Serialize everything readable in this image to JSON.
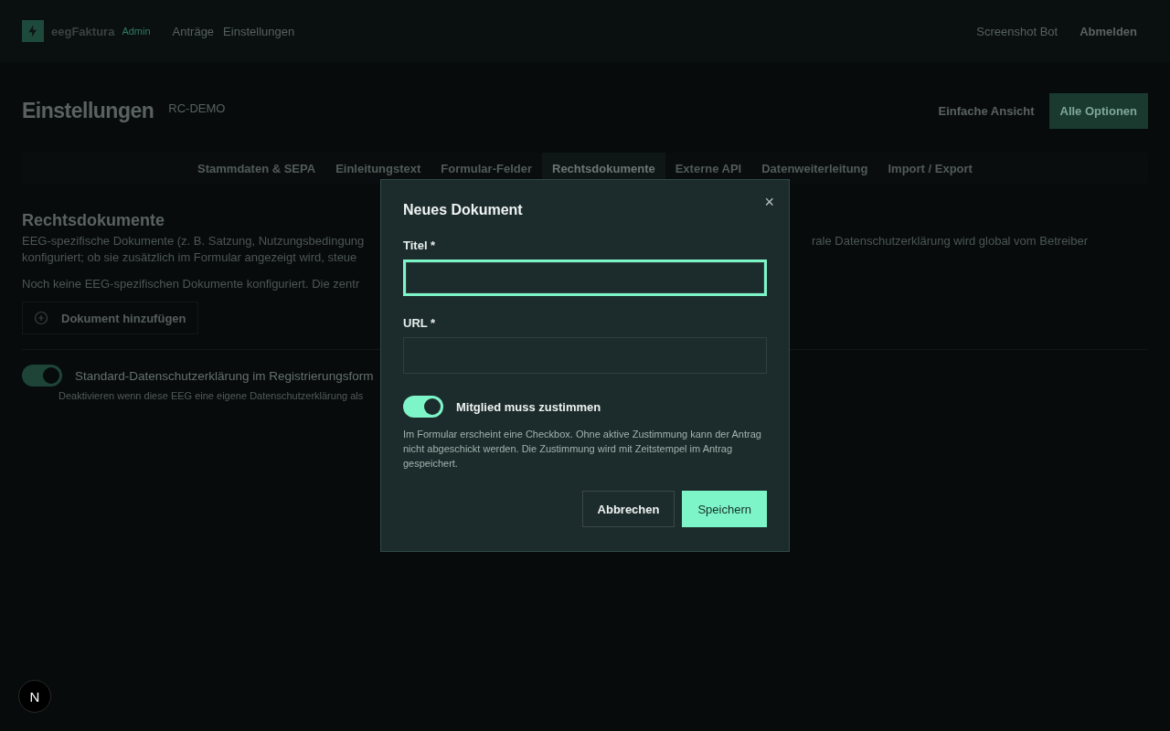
{
  "header": {
    "brand": "eegFaktura",
    "role": "Admin",
    "nav": [
      {
        "label": "Anträge"
      },
      {
        "label": "Einstellungen"
      }
    ],
    "user": "Screenshot Bot",
    "logout": "Abmelden"
  },
  "page": {
    "title": "Einstellungen",
    "tenant": "RC-DEMO",
    "view_buttons": [
      {
        "label": "Einfache Ansicht",
        "selected": false
      },
      {
        "label": "Alle Optionen",
        "selected": true
      }
    ]
  },
  "tabs": [
    {
      "label": "Stammdaten & SEPA",
      "selected": false
    },
    {
      "label": "Einleitungstext",
      "selected": false
    },
    {
      "label": "Formular-Felder",
      "selected": false
    },
    {
      "label": "Rechtsdokumente",
      "selected": true
    },
    {
      "label": "Externe API",
      "selected": false
    },
    {
      "label": "Datenweiterleitung",
      "selected": false
    },
    {
      "label": "Import / Export",
      "selected": false
    }
  ],
  "section": {
    "title": "Rechtsdokumente",
    "description_left": [
      "EEG-spezifische Dokumente (z. B. Satzung, Nutzungsbedingung",
      "konfiguriert; ob sie zusätzlich im Formular angezeigt wird, steue"
    ],
    "description_right": "rale Datenschutzerklärung wird global vom Betreiber",
    "empty_note": "Noch keine EEG-spezifischen Dokumente konfiguriert. Die zentr",
    "add_button": "Dokument hinzufügen",
    "privacy_toggle": {
      "label": "Standard-Datenschutzerklärung im Registrierungsform",
      "hint": "Deaktivieren wenn diese EEG eine eigene Datenschutzerklärung als",
      "on": true
    }
  },
  "dialog": {
    "title": "Neues Dokument",
    "close": "×",
    "fields": [
      {
        "label": "Titel *",
        "focused": true
      },
      {
        "label": "URL *",
        "focused": false
      }
    ],
    "consent_toggle": {
      "label": "Mitglied muss zustimmen",
      "on": true
    },
    "help": "Im Formular erscheint eine Checkbox. Ohne aktive Zustimmung kann der Antrag nicht abgeschickt werden. Die Zustimmung wird mit Zeitstempel im Antrag gespeichert.",
    "buttons": [
      {
        "label": "Abbrechen",
        "kind": "secondary"
      },
      {
        "label": "Speichern",
        "kind": "primary"
      }
    ]
  },
  "dev_badge": "N"
}
